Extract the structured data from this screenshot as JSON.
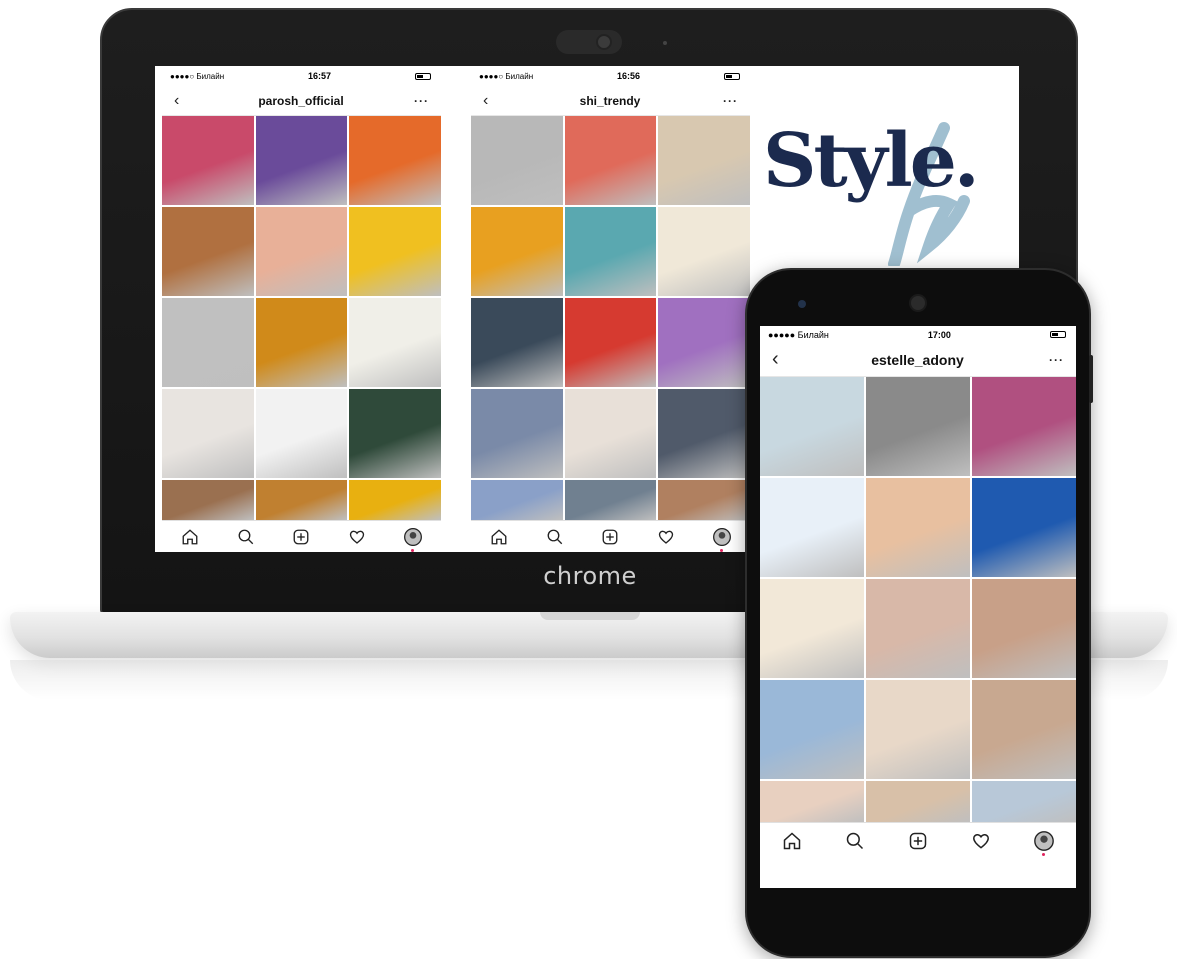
{
  "laptop": {
    "brand_label": "chrome"
  },
  "panels": {
    "left": {
      "carrier": "●●●●○ Билайн",
      "time": "16:57",
      "username": "parosh_official",
      "tiles": [
        "#c94a6a",
        "#6a4b9a",
        "#e56a2a",
        "#b07040",
        "#e8b098",
        "#f0c020",
        "#c0c0c0",
        "#d08a1a",
        "#f0efe8",
        "#e8e4e0",
        "#f2f2f2",
        "#2f4a3a",
        "#9a7050",
        "#c08030",
        "#e8b010"
      ]
    },
    "right": {
      "carrier": "●●●●○ Билайн",
      "time": "16:56",
      "username": "shi_trendy",
      "tiles": [
        "#b8b8b8",
        "#e06a5a",
        "#d8c8b0",
        "#e8a020",
        "#5aa8b0",
        "#f0e8d8",
        "#3a4a5a",
        "#d63a30",
        "#a070c0",
        "#7a8aa8",
        "#e8e0d8",
        "#505a6a",
        "#8aa0c8",
        "#708090",
        "#b08060"
      ]
    },
    "phone": {
      "carrier": "●●●●● Билайн",
      "time": "17:00",
      "username": "estelle_adony",
      "tiles": [
        "#c8d8e0",
        "#8a8a8a",
        "#b05080",
        "#e8f0f8",
        "#e8c0a0",
        "#1f5ab0",
        "#f2e8d8",
        "#d8b8a8",
        "#c8a088",
        "#9ab8d8",
        "#e8d8c8",
        "#c8a890",
        "#e8d0c0",
        "#d8c0a8",
        "#b8c8d8"
      ]
    }
  },
  "logo": {
    "word": "Style."
  },
  "colors": {
    "logo_navy": "#1b2a4e",
    "logo_script": "#8fb4c8",
    "notification": "#e0245e"
  },
  "icons": [
    "home-icon",
    "search-icon",
    "add-icon",
    "heart-icon",
    "profile-icon",
    "back-icon",
    "more-icon"
  ]
}
